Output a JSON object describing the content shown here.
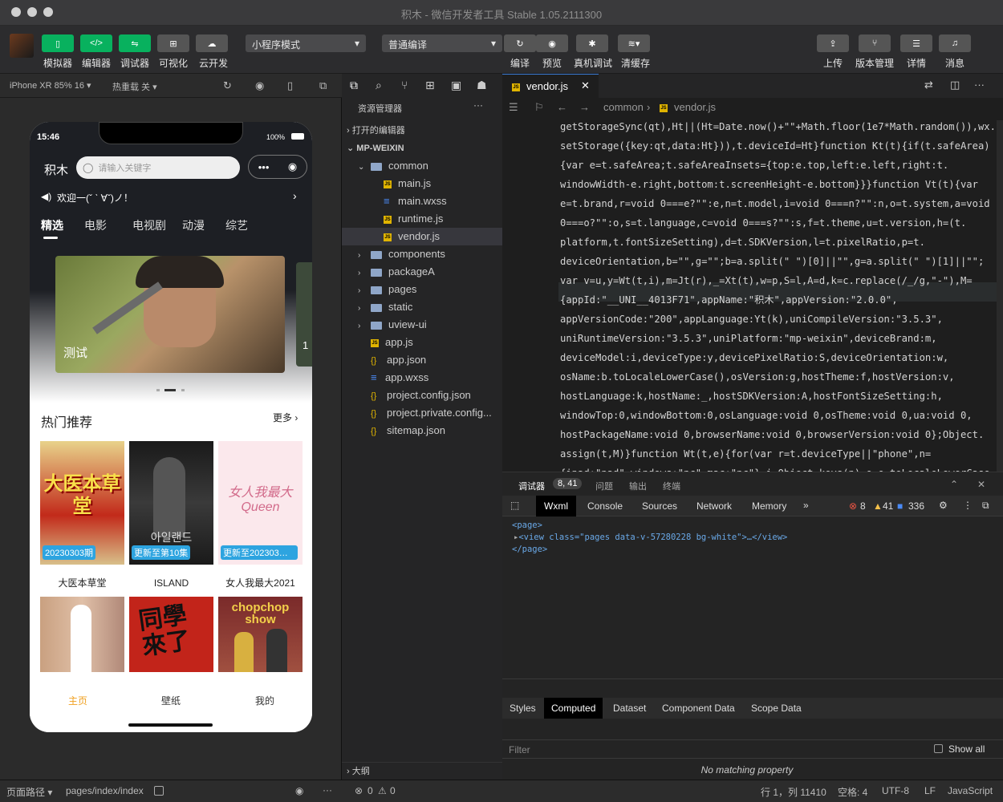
{
  "window": {
    "title": "积木 - 微信开发者工具 Stable 1.05.2111300"
  },
  "toolbar": {
    "left": [
      "模拟器",
      "编辑器",
      "调试器",
      "可视化",
      "云开发"
    ],
    "mode": "小程序模式",
    "compile": "普通编译",
    "mid": [
      "编译",
      "预览",
      "真机调试",
      "清缓存"
    ],
    "right": [
      "上传",
      "版本管理",
      "详情",
      "消息"
    ]
  },
  "simulator": {
    "device": "iPhone XR 85% 16 ▾",
    "hotreload": "热重载 关 ▾",
    "time": "15:46",
    "battery": "100%",
    "app_title": "积木",
    "search_placeholder": "请输入关键字",
    "notice": "欢迎一(ˇ ˋ ∀ˇ)ノ！",
    "tabs": [
      "精选",
      "电影",
      "电视剧",
      "动漫",
      "综艺"
    ],
    "banner_caption": "测试",
    "banner_next": "1",
    "hot_title": "热门推荐",
    "more": "更多",
    "cards": [
      {
        "badge": "20230303期",
        "name": "大医本草堂",
        "art": "大医本草堂"
      },
      {
        "badge": "更新至第10集",
        "name": "ISLAND",
        "art": "아일랜드"
      },
      {
        "badge": "更新至202303…",
        "name": "女人我最大2021",
        "art": "女人我最大 Queen"
      }
    ],
    "row2": [
      "",
      "同學來了",
      "chopchop show"
    ],
    "nav": [
      "主页",
      "壁纸",
      "我的"
    ],
    "footer_path": "页面路径 ▾",
    "path": "pages/index/index"
  },
  "explorer": {
    "title": "资源管理器",
    "open_editors": "打开的编辑器",
    "project": "MP-WEIXIN",
    "items": [
      {
        "label": "common",
        "indent": 1,
        "type": "folder-open"
      },
      {
        "label": "main.js",
        "indent": 2,
        "type": "js"
      },
      {
        "label": "main.wxss",
        "indent": 2,
        "type": "css"
      },
      {
        "label": "runtime.js",
        "indent": 2,
        "type": "js"
      },
      {
        "label": "vendor.js",
        "indent": 2,
        "type": "js",
        "active": true
      },
      {
        "label": "components",
        "indent": 1,
        "type": "folder"
      },
      {
        "label": "packageA",
        "indent": 1,
        "type": "folder"
      },
      {
        "label": "pages",
        "indent": 1,
        "type": "folder"
      },
      {
        "label": "static",
        "indent": 1,
        "type": "folder"
      },
      {
        "label": "uview-ui",
        "indent": 1,
        "type": "folder"
      },
      {
        "label": "app.js",
        "indent": 1,
        "type": "js"
      },
      {
        "label": "app.json",
        "indent": 1,
        "type": "json"
      },
      {
        "label": "app.wxss",
        "indent": 1,
        "type": "css"
      },
      {
        "label": "project.config.json",
        "indent": 1,
        "type": "json"
      },
      {
        "label": "project.private.config...",
        "indent": 1,
        "type": "json"
      },
      {
        "label": "sitemap.json",
        "indent": 1,
        "type": "json"
      }
    ],
    "outline": "大纲"
  },
  "editor": {
    "tab": "vendor.js",
    "crumb1": "common",
    "crumb2": "vendor.js",
    "lines": [
      "getStorageSync(qt),Ht||(Ht=Date.now()+\"\"+Math.floor(1e7*Math.random()),wx.",
      "setStorage({key:qt,data:Ht})),t.deviceId=Ht}function Kt(t){if(t.safeArea)",
      "{var e=t.safeArea;t.safeAreaInsets={top:e.top,left:e.left,right:t.",
      "windowWidth-e.right,bottom:t.screenHeight-e.bottom}}}function Vt(t){var",
      "e=t.brand,r=void 0===e?\"\":e,n=t.model,i=void 0===n?\"\":n,o=t.system,a=void",
      "0===o?\"\":o,s=t.language,c=void 0===s?\"\":s,f=t.theme,u=t.version,h=(t.",
      "platform,t.fontSizeSetting),d=t.SDKVersion,l=t.pixelRatio,p=t.",
      "deviceOrientation,b=\"\",g=\"\";b=a.split(\" \")[0]||\"\",g=a.split(\" \")[1]||\"\";",
      "var v=u,y=Wt(t,i),m=Jt(r),_=Xt(t),w=p,S=l,A=d,k=c.replace(/_/g,\"-\"),M=",
      "{appId:\"__UNI__4013F71\",appName:\"积木\",appVersion:\"2.0.0\",",
      "appVersionCode:\"200\",appLanguage:Yt(k),uniCompileVersion:\"3.5.3\",",
      "uniRuntimeVersion:\"3.5.3\",uniPlatform:\"mp-weixin\",deviceBrand:m,",
      "deviceModel:i,deviceType:y,devicePixelRatio:S,deviceOrientation:w,",
      "osName:b.toLocaleLowerCase(),osVersion:g,hostTheme:f,hostVersion:v,",
      "hostLanguage:k,hostName:_,hostSDKVersion:A,hostFontSizeSetting:h,",
      "windowTop:0,windowBottom:0,osLanguage:void 0,osTheme:void 0,ua:void 0,",
      "hostPackageName:void 0,browserName:void 0,browserVersion:void 0};Object.",
      "assign(t,M)}function Wt(t,e){for(var r=t.deviceType||\"phone\",n=",
      "{ipad:\"pad\",windows:\"pc\",mac:\"pc\"},i=Object.keys(n),o=e.toLocaleLowerCase"
    ]
  },
  "debugger": {
    "tabs": [
      "调试器",
      "问题",
      "输出",
      "终端"
    ],
    "badge": "8, 41",
    "devtabs": [
      "Wxml",
      "Console",
      "Sources",
      "Network",
      "Memory"
    ],
    "errors": "8",
    "warnings": "41",
    "infos": "336",
    "xml": [
      "<page>",
      "<view class=\"pages data-v-57280228 bg-white\">…</view>",
      "</page>"
    ],
    "subtabs": [
      "Styles",
      "Computed",
      "Dataset",
      "Component Data",
      "Scope Data"
    ],
    "filter": "Filter",
    "showall": "Show all",
    "nomatch": "No matching property"
  },
  "status": {
    "problems_e": "0",
    "problems_w": "0",
    "pos": "行 1，列 11410",
    "spaces": "空格: 4",
    "enc": "UTF-8",
    "eol": "LF",
    "lang": "JavaScript"
  }
}
